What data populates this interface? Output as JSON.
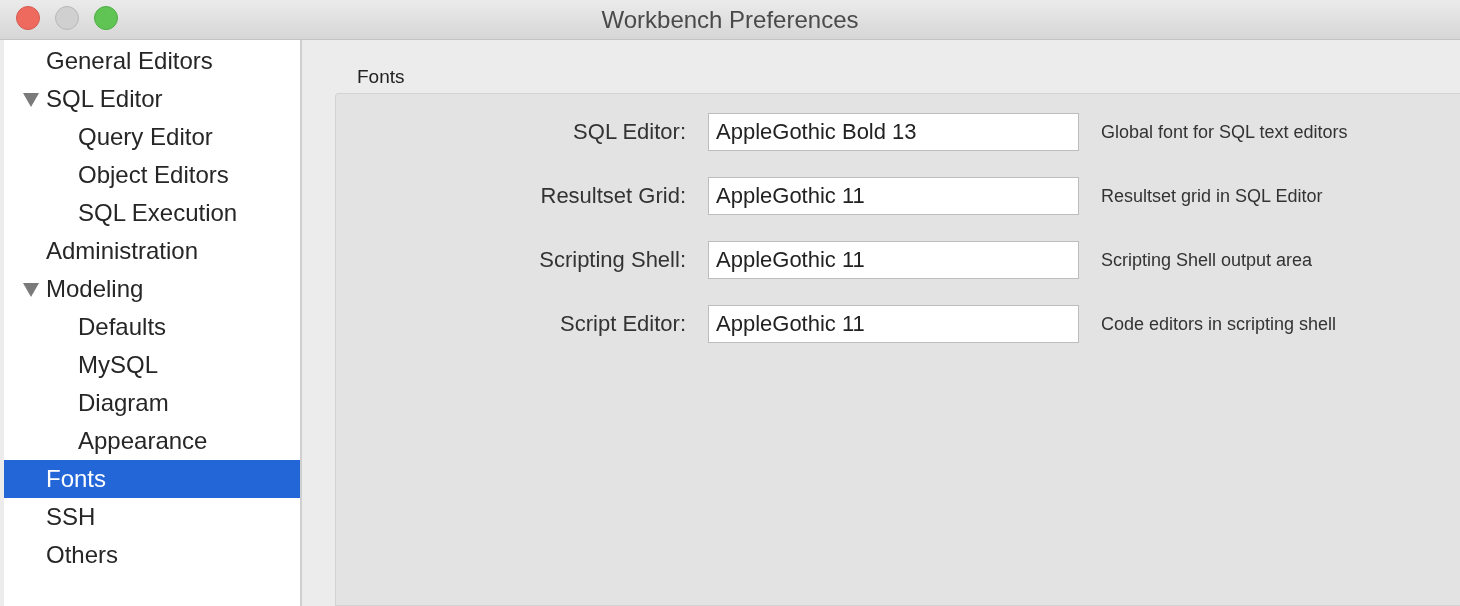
{
  "window": {
    "title": "Workbench Preferences"
  },
  "sidebar": {
    "items": [
      {
        "label": "General Editors",
        "selected": false
      },
      {
        "label": "SQL Editor",
        "selected": false,
        "expanded": true,
        "children": [
          {
            "label": "Query Editor",
            "selected": false
          },
          {
            "label": "Object Editors",
            "selected": false
          },
          {
            "label": "SQL Execution",
            "selected": false
          }
        ]
      },
      {
        "label": "Administration",
        "selected": false
      },
      {
        "label": "Modeling",
        "selected": false,
        "expanded": true,
        "children": [
          {
            "label": "Defaults",
            "selected": false
          },
          {
            "label": "MySQL",
            "selected": false
          },
          {
            "label": "Diagram",
            "selected": false
          },
          {
            "label": "Appearance",
            "selected": false
          }
        ]
      },
      {
        "label": "Fonts",
        "selected": true
      },
      {
        "label": "SSH",
        "selected": false
      },
      {
        "label": "Others",
        "selected": false
      }
    ]
  },
  "fonts_section": {
    "title": "Fonts",
    "rows": [
      {
        "label": "SQL Editor:",
        "value": "AppleGothic Bold 13",
        "description": "Global font for SQL text editors"
      },
      {
        "label": "Resultset Grid:",
        "value": "AppleGothic 11",
        "description": "Resultset grid in SQL Editor"
      },
      {
        "label": "Scripting Shell:",
        "value": "AppleGothic 11",
        "description": "Scripting Shell output area"
      },
      {
        "label": "Script Editor:",
        "value": "AppleGothic 11",
        "description": "Code editors in scripting shell"
      }
    ]
  }
}
